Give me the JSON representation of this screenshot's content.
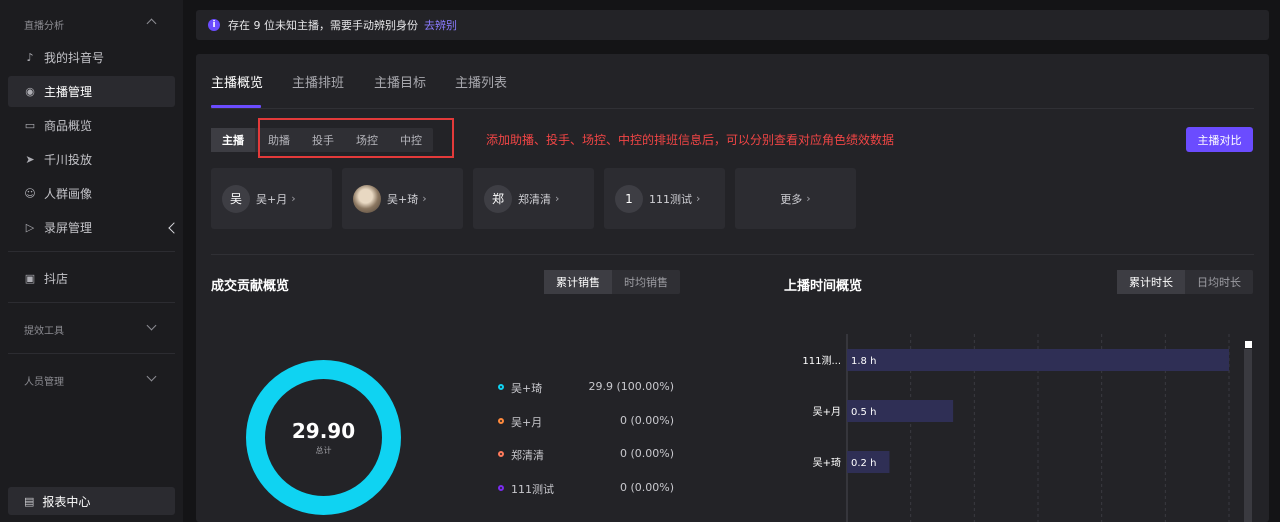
{
  "sidebar": {
    "groups": {
      "live_analysis": "直播分析",
      "efficiency_tools": "提效工具",
      "staff_management": "人员管理"
    },
    "items": [
      {
        "label": "我的抖音号",
        "icon": "tiktok-icon"
      },
      {
        "label": "主播管理",
        "icon": "user-circle-icon"
      },
      {
        "label": "商品概览",
        "icon": "product-box-icon"
      },
      {
        "label": "千川投放",
        "icon": "send-arrow-icon"
      },
      {
        "label": "人群画像",
        "icon": "persona-icon"
      },
      {
        "label": "录屏管理",
        "icon": "record-play-icon"
      },
      {
        "label": "抖店",
        "icon": "shop-bag-icon"
      }
    ],
    "report_center": "报表中心"
  },
  "notice": {
    "text": "存在 9 位未知主播，需要手动辨别身份",
    "link": "去辨别"
  },
  "tabs": [
    "主播概览",
    "主播排班",
    "主播目标",
    "主播列表"
  ],
  "roles": [
    "主播",
    "助播",
    "投手",
    "场控",
    "中控"
  ],
  "annotation": "添加助播、投手、场控、中控的排班信息后，可以分别查看对应角色绩效数据",
  "compare_button": "主播对比",
  "anchors": [
    {
      "avatar": "吴",
      "name": "吴+月"
    },
    {
      "avatar": "",
      "name": "吴+琦"
    },
    {
      "avatar": "郑",
      "name": "郑清清"
    },
    {
      "avatar": "1",
      "name": "111测试"
    }
  ],
  "more_label": "更多",
  "contribution": {
    "title": "成交贡献概览",
    "options": [
      "累计销售",
      "时均销售"
    ],
    "total": "29.90",
    "total_label": "总计",
    "legend": [
      {
        "name": "吴+琦",
        "value": "29.9 (100.00%)",
        "color": "#0fd3f2"
      },
      {
        "name": "吴+月",
        "value": "0 (0.00%)",
        "color": "#ff8a3d"
      },
      {
        "name": "郑清清",
        "value": "0 (0.00%)",
        "color": "#ff7a5c"
      },
      {
        "name": "111测试",
        "value": "0 (0.00%)",
        "color": "#7b2cf0"
      }
    ]
  },
  "live_time": {
    "title": "上播时间概览",
    "options": [
      "累计时长",
      "日均时长"
    ]
  },
  "chart_data": {
    "type": "bar",
    "orientation": "horizontal",
    "categories": [
      "111测...",
      "吴+月",
      "吴+琦"
    ],
    "values": [
      1.8,
      0.5,
      0.2
    ],
    "value_labels": [
      "1.8 h",
      "0.5 h",
      "0.2 h"
    ],
    "xlim": [
      0,
      1.8
    ],
    "grid": true,
    "bar_color": "#2f2f55"
  }
}
